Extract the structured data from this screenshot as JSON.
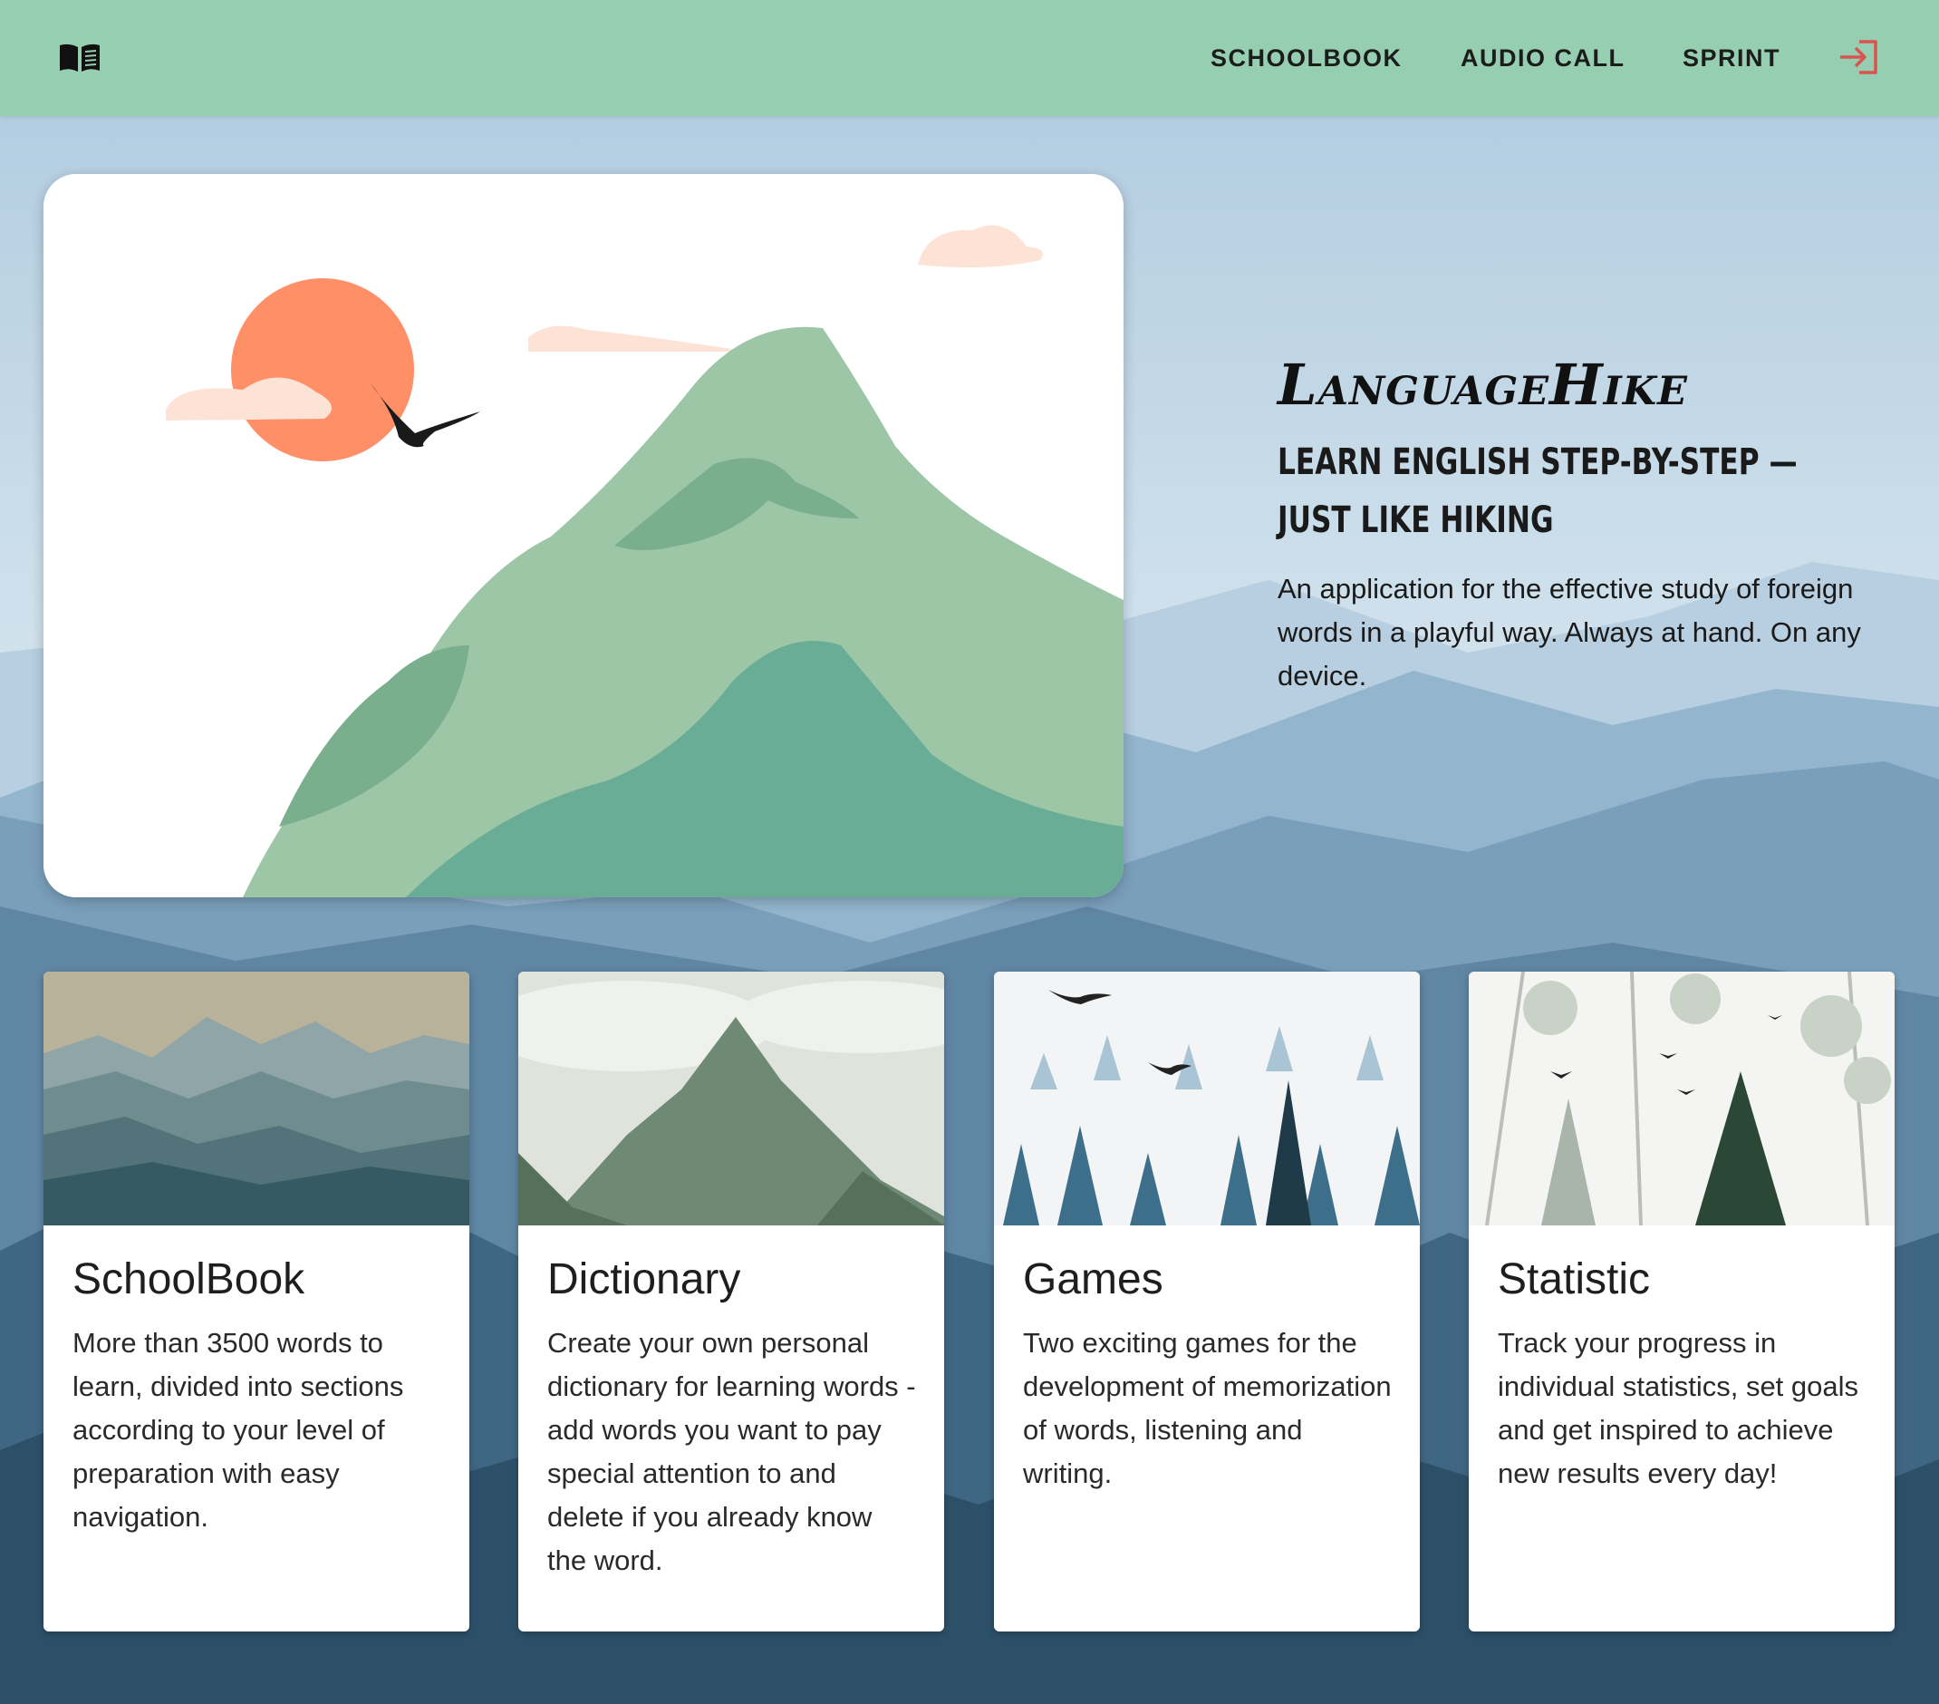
{
  "header": {
    "logo_icon": "open-book-icon",
    "nav": [
      {
        "label": "SCHOOLBOOK"
      },
      {
        "label": "AUDIO CALL"
      },
      {
        "label": "SPRINT"
      }
    ],
    "login_icon": "login-arrow-icon",
    "login_color": "#d9534f"
  },
  "hero": {
    "title": "LanguageHike",
    "subtitle": "LEARN ENGLISH STEP-BY-STEP — JUST LIKE HIKING",
    "description": "An application for the effective study of foreign words in a playful way. Always at hand. On any device."
  },
  "cards": [
    {
      "title": "SchoolBook",
      "text": "More than 3500 words to learn, divided into sections according to your level of preparation with easy navigation."
    },
    {
      "title": "Dictionary",
      "text": "Create your own personal dictionary for learning words - add words you want to pay special attention to and delete if you already know the word."
    },
    {
      "title": "Games",
      "text": "Two exciting games for the development of memorization of words, listening and writing."
    },
    {
      "title": "Statistic",
      "text": "Track your progress in individual statistics, set goals and get inspired to achieve new results every day!"
    }
  ],
  "colors": {
    "header_bg": "#96ceb2",
    "sun": "#ff8f66",
    "mountain": "#9cc6a6"
  }
}
